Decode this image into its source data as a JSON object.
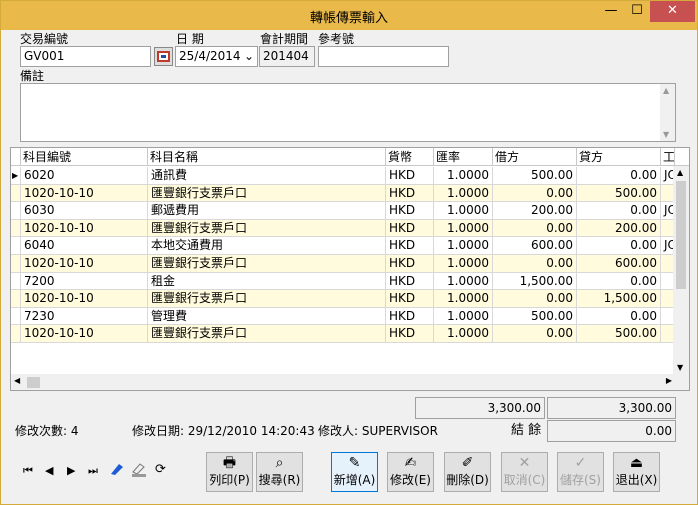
{
  "window": {
    "title": "轉帳傳票輸入",
    "minimize": "—",
    "maximize": "☐",
    "close": "✕"
  },
  "header": {
    "txn_no_label": "交易編號",
    "txn_no_value": "GV001",
    "date_label": "日 期",
    "date_value": "25/4/2014",
    "period_label": "會計期間",
    "period_value": "201404",
    "ref_label": "參考號",
    "ref_value": "",
    "remark_label": "備註",
    "remark_value": ""
  },
  "grid": {
    "columns": [
      "科目編號",
      "科目名稱",
      "貨幣",
      "匯率",
      "借方",
      "貸方",
      "工"
    ],
    "rows": [
      {
        "code": "6020",
        "name": "通訊費",
        "cur": "HKD",
        "rate": "1.0000",
        "debit": "500.00",
        "credit": "0.00",
        "x": "JO"
      },
      {
        "code": "1020-10-10",
        "name": "匯豐銀行支票戶口",
        "cur": "HKD",
        "rate": "1.0000",
        "debit": "0.00",
        "credit": "500.00",
        "x": ""
      },
      {
        "code": "6030",
        "name": "郵遞費用",
        "cur": "HKD",
        "rate": "1.0000",
        "debit": "200.00",
        "credit": "0.00",
        "x": "JO"
      },
      {
        "code": "1020-10-10",
        "name": "匯豐銀行支票戶口",
        "cur": "HKD",
        "rate": "1.0000",
        "debit": "0.00",
        "credit": "200.00",
        "x": ""
      },
      {
        "code": "6040",
        "name": "本地交通費用",
        "cur": "HKD",
        "rate": "1.0000",
        "debit": "600.00",
        "credit": "0.00",
        "x": "JO"
      },
      {
        "code": "1020-10-10",
        "name": "匯豐銀行支票戶口",
        "cur": "HKD",
        "rate": "1.0000",
        "debit": "0.00",
        "credit": "600.00",
        "x": ""
      },
      {
        "code": "7200",
        "name": "租金",
        "cur": "HKD",
        "rate": "1.0000",
        "debit": "1,500.00",
        "credit": "0.00",
        "x": ""
      },
      {
        "code": "1020-10-10",
        "name": "匯豐銀行支票戶口",
        "cur": "HKD",
        "rate": "1.0000",
        "debit": "0.00",
        "credit": "1,500.00",
        "x": ""
      },
      {
        "code": "7230",
        "name": "管理費",
        "cur": "HKD",
        "rate": "1.0000",
        "debit": "500.00",
        "credit": "0.00",
        "x": ""
      },
      {
        "code": "1020-10-10",
        "name": "匯豐銀行支票戶口",
        "cur": "HKD",
        "rate": "1.0000",
        "debit": "0.00",
        "credit": "500.00",
        "x": ""
      }
    ],
    "row_colors": {
      "even": "#ffffff",
      "odd": "#fffbdc"
    }
  },
  "totals": {
    "debit": "3,300.00",
    "credit": "3,300.00",
    "balance_label": "結 餘",
    "balance": "0.00"
  },
  "status": {
    "edit_count": "修改次數: 4",
    "edit_date": "修改日期: 29/12/2010 14:20:43",
    "editor": "修改人: SUPERVISOR"
  },
  "nav": {
    "first": "⏮",
    "prev": "◀",
    "next": "▶",
    "last": "⏭"
  },
  "buttons": {
    "print": "列印(P)",
    "search": "搜尋(R)",
    "add": "新增(A)",
    "edit": "修改(E)",
    "delete": "刪除(D)",
    "cancel": "取消(C)",
    "save": "儲存(S)",
    "exit": "退出(X)"
  }
}
